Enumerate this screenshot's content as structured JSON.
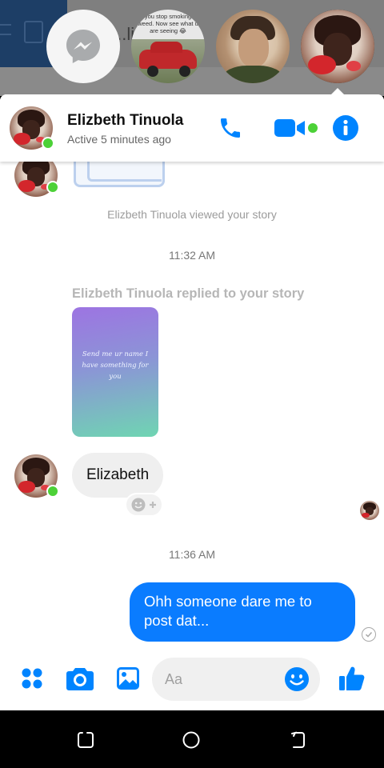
{
  "background_app": {
    "text": "...lid..."
  },
  "chat_heads": {
    "story_caption": "you stop smoking weed. Now see what u are seeing 😂"
  },
  "header": {
    "contact_name": "Elizbeth Tinuola",
    "status": "Active 5 minutes ago",
    "icons": [
      "phone-icon",
      "video-camera-icon",
      "info-icon"
    ],
    "accent_color": "#0084ff",
    "online_color": "#4cd137"
  },
  "messages": {
    "system_viewed": "Elizbeth Tinuola viewed your story",
    "time_1": "11:32 AM",
    "story_reply_label": "Elizbeth Tinuola replied to your story",
    "story_text": "Send me ur name I have something for you",
    "incoming_text": "Elizabeth",
    "time_2": "11:36 AM",
    "outgoing_text": "Ohh someone dare me to post dat...",
    "outgoing_bubble_color": "#0a7cff"
  },
  "composer": {
    "placeholder": "Aa",
    "icons": [
      "menu-dots-icon",
      "camera-icon",
      "gallery-icon",
      "emoji-icon",
      "thumbs-up-icon"
    ]
  },
  "navbar": {
    "icons": [
      "recent-apps-icon",
      "home-icon",
      "back-icon"
    ]
  }
}
